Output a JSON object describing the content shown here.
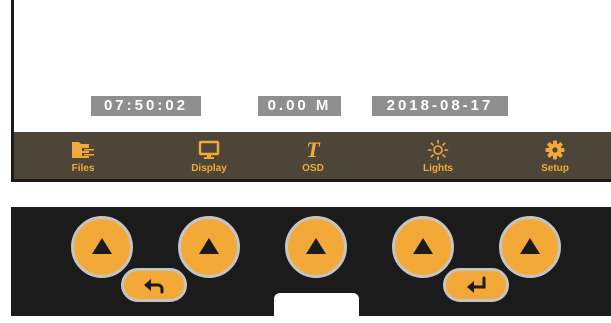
{
  "overlay": {
    "time": "07:50:02",
    "distance": "0.00 M",
    "date": "2018-08-17"
  },
  "menu": {
    "items": [
      {
        "label": "Files",
        "icon": "folder-icon"
      },
      {
        "label": "Display",
        "icon": "monitor-icon"
      },
      {
        "label": "OSD",
        "icon": "text-t-icon",
        "glyph": "T"
      },
      {
        "label": "Lights",
        "icon": "sun-icon"
      },
      {
        "label": "Setup",
        "icon": "gear-icon"
      }
    ]
  },
  "keypad": {
    "up_buttons": [
      "arrow-up-icon",
      "arrow-up-icon",
      "arrow-up-icon",
      "arrow-up-icon",
      "arrow-up-icon"
    ],
    "back_icon": "back-arrow-icon",
    "enter_icon": "enter-arrow-icon"
  },
  "colors": {
    "accent": "#f2a938",
    "menu_bar": "#4d4538",
    "overlay_bg": "#8f8f8f",
    "frame": "#1b1b1b"
  }
}
